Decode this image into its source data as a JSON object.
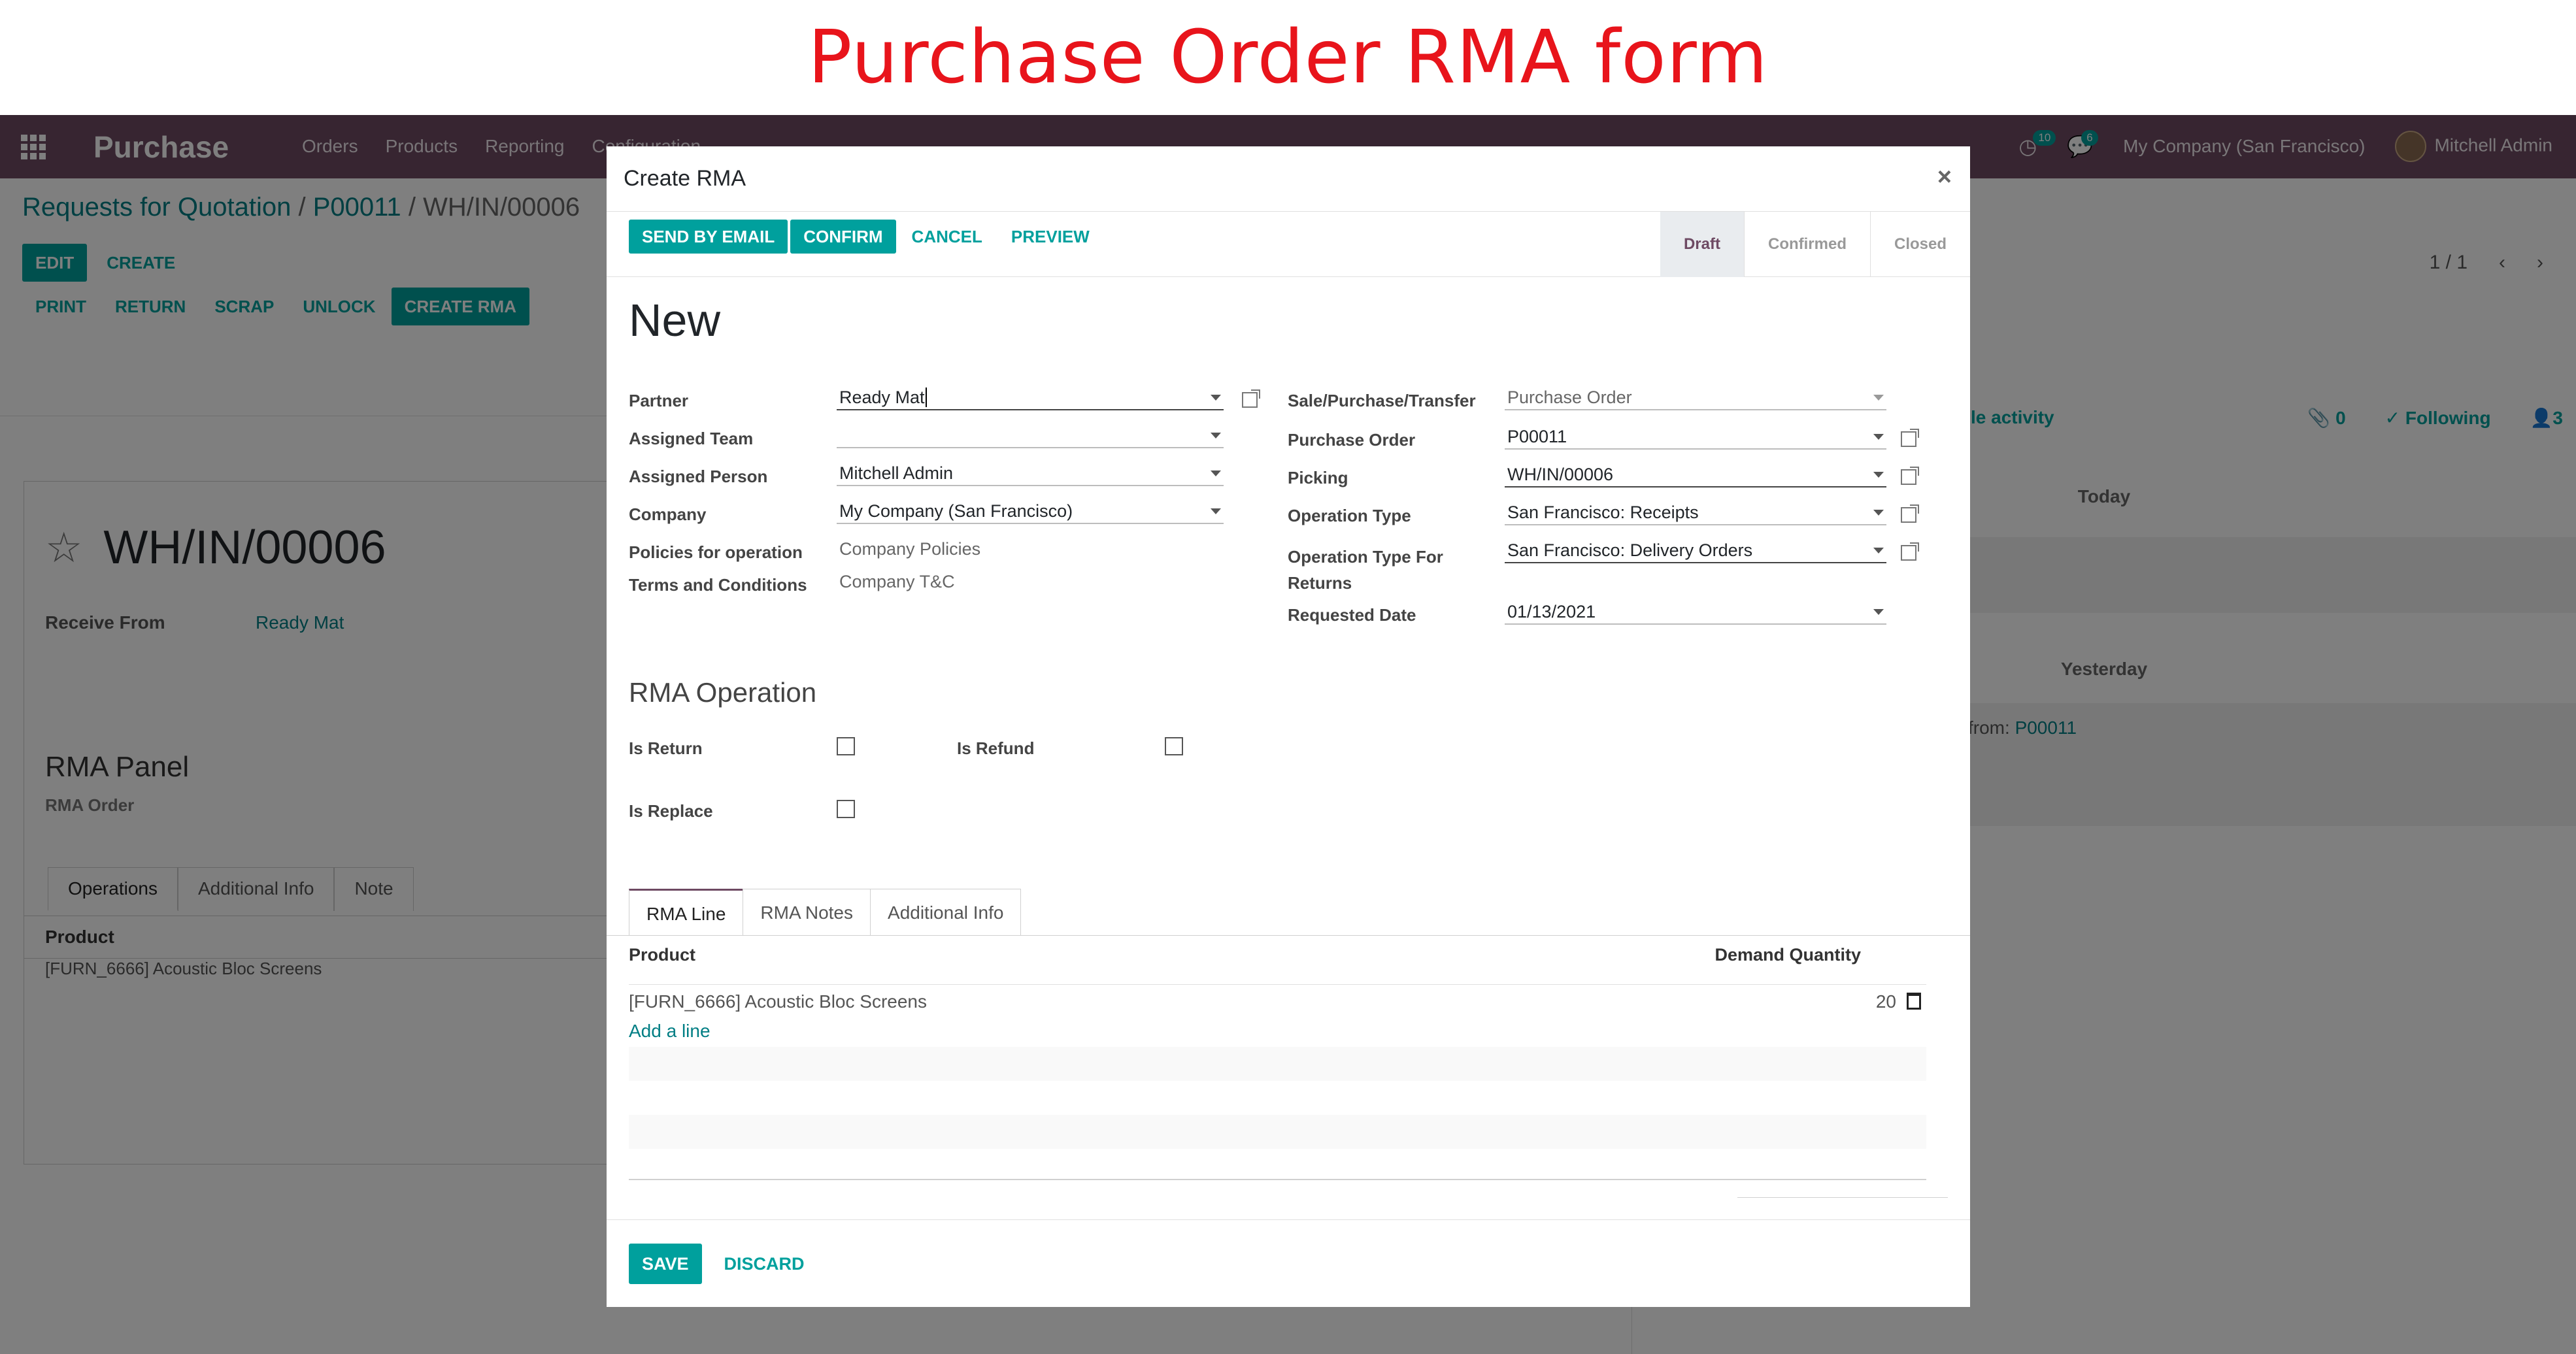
{
  "banner": {
    "title": "Purchase Order RMA form"
  },
  "navbar": {
    "app_name": "Purchase",
    "menu": [
      "Orders",
      "Products",
      "Reporting",
      "Configuration"
    ],
    "activity_count": "10",
    "message_count": "6",
    "company": "My Company (San Francisco)",
    "user": "Mitchell Admin"
  },
  "background": {
    "breadcrumb": [
      "Requests for Quotation",
      "P00011",
      "WH/IN/00006"
    ],
    "breadcrumb_sep": "/",
    "edit": "Edit",
    "create": "Create",
    "actions": [
      "Print",
      "Return",
      "Scrap",
      "Unlock",
      "Create RMA"
    ],
    "pager": "1 / 1",
    "record_name": "WH/IN/00006",
    "receive_from_label": "Receive From",
    "receive_from_value": "Ready Mat",
    "rma_panel_title": "RMA Panel",
    "rma_order_label": "RMA Order",
    "tabs": [
      "Operations",
      "Additional Info",
      "Note"
    ],
    "product_header": "Product",
    "product_row": "[FURN_6666] Acoustic Bloc Screens",
    "chatter": {
      "schedule": "le activity",
      "attachments": "0",
      "following": "Following",
      "followers": "3",
      "today": "Today",
      "yesterday": "Yesterday",
      "msg_prefix": "from: ",
      "msg_link": "P00011"
    }
  },
  "modal": {
    "title": "Create RMA",
    "close": "×",
    "buttons": [
      "Send by Email",
      "Confirm",
      "Cancel",
      "Preview"
    ],
    "statuses": [
      "Draft",
      "Confirmed",
      "Closed"
    ],
    "active_status": "Draft",
    "name": "New",
    "left_fields": [
      {
        "label": "Partner",
        "value": "Ready Mat"
      },
      {
        "label": "Assigned Team",
        "value": ""
      },
      {
        "label": "Assigned Person",
        "value": "Mitchell Admin"
      },
      {
        "label": "Company",
        "value": "My Company (San Francisco)"
      },
      {
        "label": "Policies for operation",
        "value": "Company Policies"
      },
      {
        "label": "Terms and Conditions",
        "value": "Company T&C"
      }
    ],
    "right_fields": [
      {
        "label": "Sale/Purchase/Transfer",
        "value": "Purchase Order"
      },
      {
        "label": "Purchase Order",
        "value": "P00011"
      },
      {
        "label": "Picking",
        "value": "WH/IN/00006"
      },
      {
        "label": "Operation Type",
        "value": "San Francisco: Receipts"
      },
      {
        "label": "Operation Type For Returns",
        "value": "San Francisco: Delivery Orders"
      },
      {
        "label": "Requested Date",
        "value": "01/13/2021"
      }
    ],
    "rma_operation_title": "RMA Operation",
    "checkboxes": [
      {
        "label": "Is Return",
        "checked": false
      },
      {
        "label": "Is Refund",
        "checked": false
      },
      {
        "label": "Is Replace",
        "checked": false
      }
    ],
    "tabs": [
      "RMA Line",
      "RMA Notes",
      "Additional Info"
    ],
    "active_tab": "RMA Line",
    "lines_header": {
      "product": "Product",
      "qty": "Demand Quantity"
    },
    "lines": [
      {
        "product": "[FURN_6666] Acoustic Bloc Screens",
        "qty": "20"
      }
    ],
    "add_line": "Add a line",
    "footer": {
      "save": "Save",
      "discard": "Discard"
    }
  },
  "colors": {
    "banner_title": "#e8141b",
    "navbar": "#6e4a63",
    "primary": "#00a09d",
    "link": "#017e84"
  }
}
